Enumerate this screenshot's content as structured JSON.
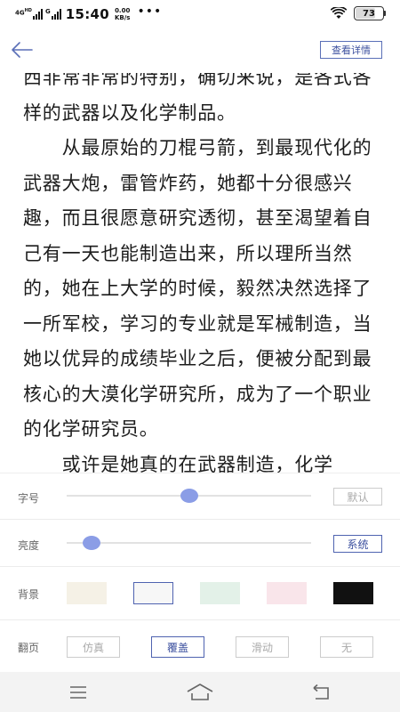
{
  "status_bar": {
    "network_label": "4G",
    "network_sub": "HD",
    "carrier_g": "G",
    "time": "15:40",
    "net_speed_value": "0.00",
    "net_speed_unit": "KB/s",
    "more": "•••",
    "battery_level": "73"
  },
  "header": {
    "back_icon": "arrow-left-icon",
    "detail_button_label": "查看详情"
  },
  "reader": {
    "paragraphs": [
      "西非常非常的特别，确切来说，是各式各样的武器以及化学制品。",
      "　　从最原始的刀棍弓箭，到最现代化的武器大炮，雷管炸药，她都十分很感兴趣，而且很愿意研究透彻，甚至渴望着自己有一天也能制造出来，所以理所当然的，她在上大学的时候，毅然决然选择了一所军校，学习的专业就是军械制造，当她以优异的成绩毕业之后，便被分配到最核心的大漠化学研究所，成为了一个职业的化学研究员。",
      "　　或许是她真的在武器制造，化学"
    ]
  },
  "settings": {
    "font_size": {
      "label": "字号",
      "level": 0.5,
      "button": "默认"
    },
    "brightness": {
      "label": "亮度",
      "level": 0.1,
      "button": "系统"
    },
    "background": {
      "label": "背景",
      "options": [
        "#f5f1e6",
        "#f7f7f7",
        "#e3f1e8",
        "#f9e5ea",
        "#111111"
      ],
      "selected_index": 1
    },
    "page_turn": {
      "label": "翻页",
      "options": [
        "仿真",
        "覆盖",
        "滑动",
        "无"
      ],
      "selected_index": 1
    }
  },
  "nav_bar": {
    "menu_icon": "menu-icon",
    "home_icon": "home-icon",
    "back_icon": "back-icon"
  },
  "colors": {
    "accent": "#4f63b0",
    "slider_thumb": "#8b9de6"
  }
}
